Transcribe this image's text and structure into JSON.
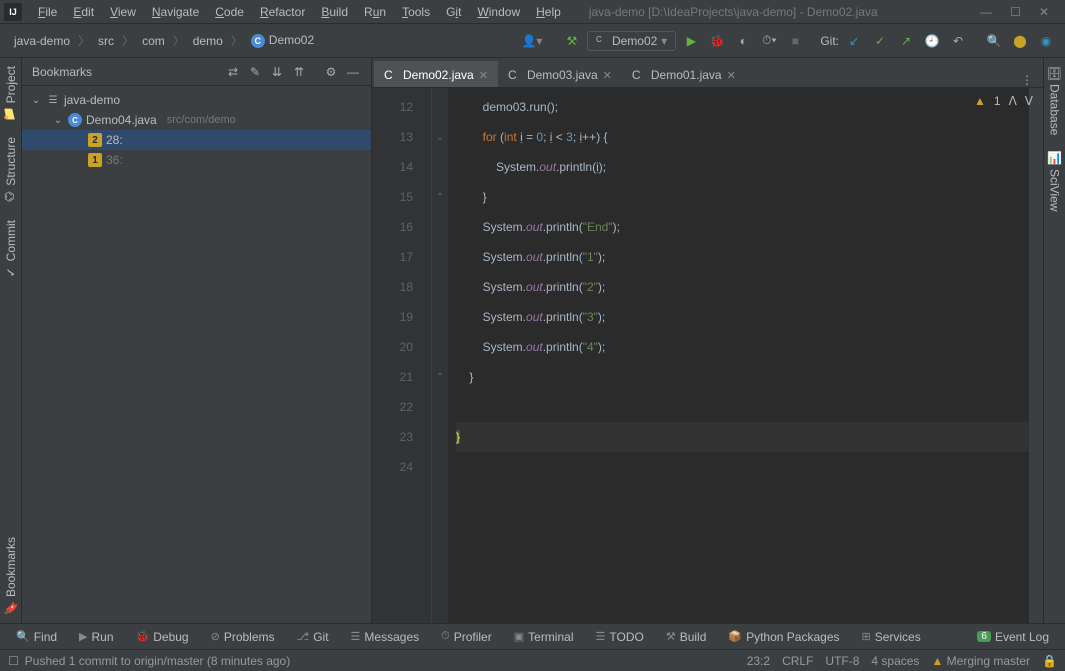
{
  "menu": {
    "items": [
      "File",
      "Edit",
      "View",
      "Navigate",
      "Code",
      "Refactor",
      "Build",
      "Run",
      "Tools",
      "Git",
      "Window",
      "Help"
    ]
  },
  "window_title": "java-demo [D:\\IdeaProjects\\java-demo] - Demo02.java",
  "breadcrumb": [
    "java-demo",
    "src",
    "com",
    "demo",
    "Demo02"
  ],
  "run_config": "Demo02",
  "git_label": "Git:",
  "left_tabs": {
    "project": "Project",
    "commit": "Commit",
    "structure": "Structure",
    "bookmarks": "Bookmarks"
  },
  "right_tabs": {
    "database": "Database",
    "sciview": "SciView"
  },
  "panel": {
    "title": "Bookmarks",
    "tree": {
      "root": "java-demo",
      "file": "Demo04.java",
      "file_path": "src/com/demo",
      "bm1_mn": "2",
      "bm1_label": "28:",
      "bm2_mn": "1",
      "bm2_label": "36:"
    }
  },
  "tabs": [
    {
      "name": "Demo02.java",
      "active": true
    },
    {
      "name": "Demo03.java",
      "active": false
    },
    {
      "name": "Demo01.java",
      "active": false
    }
  ],
  "editor": {
    "lines": [
      "12",
      "13",
      "14",
      "15",
      "16",
      "17",
      "18",
      "19",
      "20",
      "21",
      "22",
      "23",
      "24"
    ],
    "warn_count": "1"
  },
  "code": {
    "l12a": "demo03.run();",
    "l13_for": "for",
    "l13_int": "int",
    "l13_eq": " = ",
    "l13_zero": "0",
    "l13_lt": " < ",
    "l13_three": "3",
    "l13_inc": "++) {",
    "l14a": "System.",
    "l14b": "out",
    "l14c": ".println(",
    "l14d": ");",
    "l15": "}",
    "l16a": "System.",
    "l16b": "out",
    "l16c": ".println(",
    "l16s": "\"End\"",
    "l16d": ");",
    "l17s": "\"1\"",
    "l18s": "\"2\"",
    "l19s": "\"3\"",
    "l20s": "\"4\"",
    "l21": "}",
    "l23": "}",
    "var_i": "i"
  },
  "tools": {
    "find": "Find",
    "run": "Run",
    "debug": "Debug",
    "problems": "Problems",
    "git": "Git",
    "messages": "Messages",
    "profiler": "Profiler",
    "terminal": "Terminal",
    "todo": "TODO",
    "build": "Build",
    "python": "Python Packages",
    "services": "Services",
    "eventlog": "Event Log",
    "event_badge": "6"
  },
  "status": {
    "vcs_msg": "Pushed 1 commit to origin/master (8 minutes ago)",
    "pos": "23:2",
    "eol": "CRLF",
    "enc": "UTF-8",
    "indent": "4 spaces",
    "branch": "Merging master"
  }
}
